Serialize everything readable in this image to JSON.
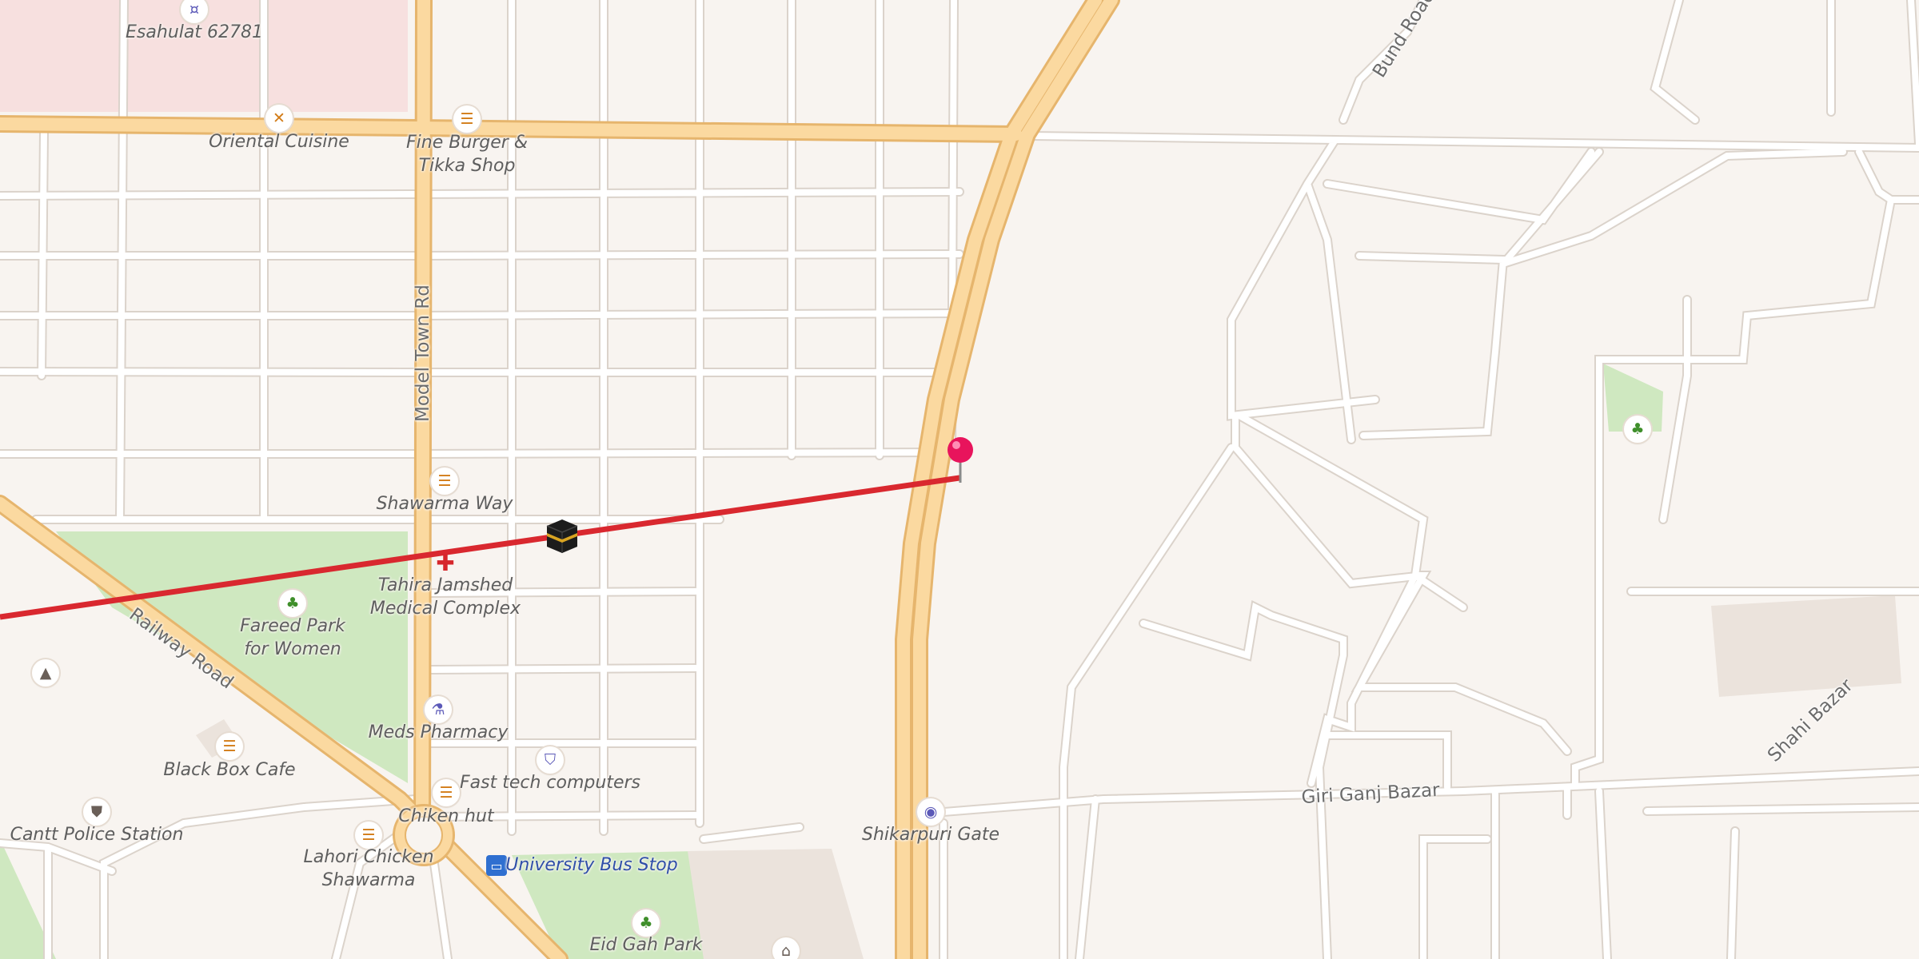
{
  "map": {
    "colors": {
      "background": "#f8f4f0",
      "primary_road": "#fbd9a0",
      "primary_road_casing": "#e6b56d",
      "minor_road": "#ffffff",
      "minor_road_casing": "#dbd3cb",
      "park": "#cfe8c0",
      "campus": "#f7e0df",
      "building": "#ebe3dc",
      "route_line": "#d9282f",
      "pin": "#e8145c"
    },
    "route": {
      "label": "red route line",
      "destination_icon": "kaaba-icon"
    },
    "pin": {
      "icon": "map-pin-icon"
    }
  },
  "roads": [
    {
      "name": "Model Town Rd"
    },
    {
      "name": "Railway Road"
    },
    {
      "name": "Bund Road"
    },
    {
      "name": "Giri Ganj Bazar"
    },
    {
      "name": "Shahi Bazar"
    }
  ],
  "pois": [
    {
      "name": "Esahulat 62781",
      "icon": "money-icon"
    },
    {
      "name": "Oriental Cuisine",
      "icon": "restaurant-icon"
    },
    {
      "name": "Fine Burger &\nTikka Shop",
      "icon": "fast-food-icon"
    },
    {
      "name": "Shawarma Way",
      "icon": "fast-food-icon"
    },
    {
      "name": "Tahira Jamshed\nMedical Complex",
      "icon": "hospital-icon"
    },
    {
      "name": "Fareed Park\nfor Women",
      "icon": "park-icon"
    },
    {
      "name": "Meds Pharmacy",
      "icon": "pharmacy-icon"
    },
    {
      "name": "Fast tech computers",
      "icon": "shop-icon"
    },
    {
      "name": "Black Box Cafe",
      "icon": "fast-food-icon"
    },
    {
      "name": "Chiken hut",
      "icon": "fast-food-icon"
    },
    {
      "name": "Cantt Police Station",
      "icon": "police-icon"
    },
    {
      "name": "Lahori Chicken\nShawarma",
      "icon": "fast-food-icon"
    },
    {
      "name": "University Bus Stop",
      "icon": "bus-stop-icon"
    },
    {
      "name": "Eid Gah Park",
      "icon": "park-icon"
    },
    {
      "name": "Shikarpuri Gate",
      "icon": "camera-icon"
    },
    {
      "name": "",
      "icon": "school-icon"
    },
    {
      "name": "",
      "icon": "park-icon"
    },
    {
      "name": "",
      "icon": "mosque-icon"
    }
  ]
}
